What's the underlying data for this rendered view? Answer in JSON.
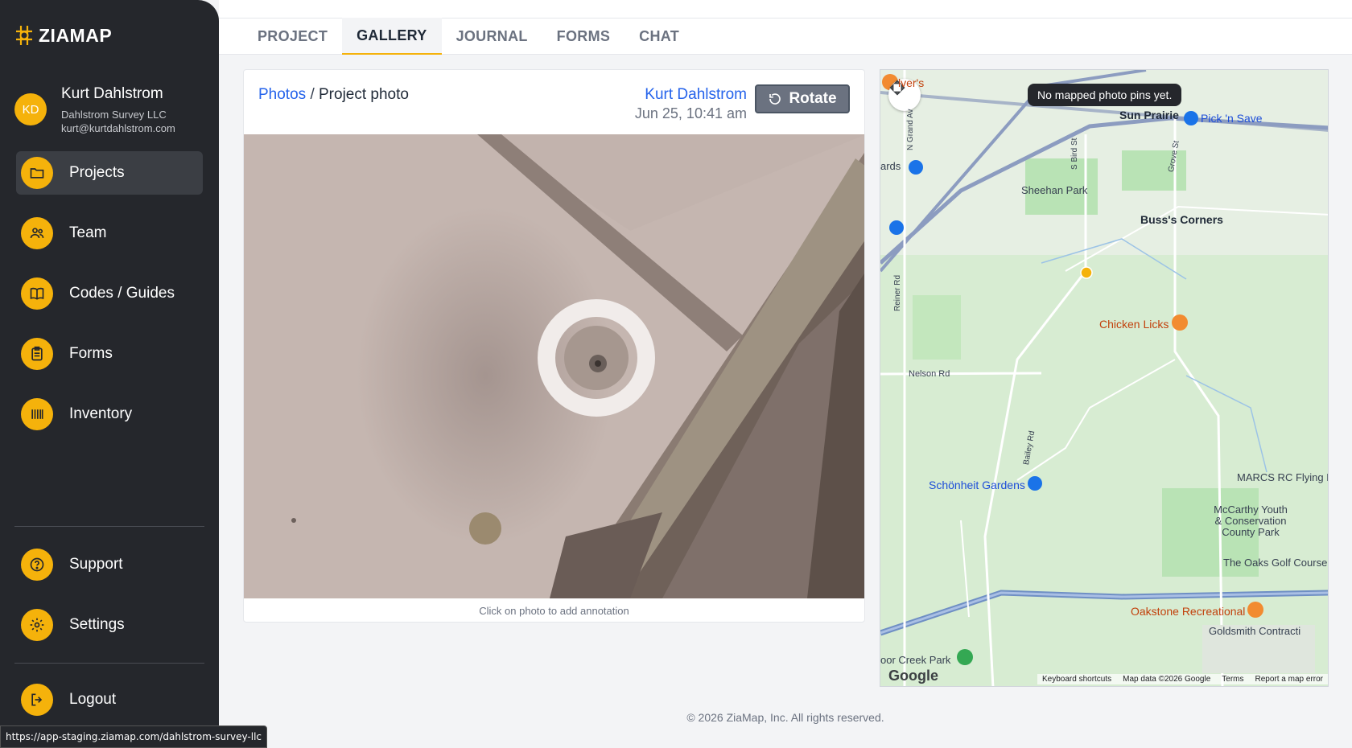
{
  "brand": {
    "name": "ZIAMAP"
  },
  "user": {
    "initials": "KD",
    "name": "Kurt Dahlstrom",
    "company": "Dahlstrom Survey LLC",
    "email": "kurt@kurtdahlstrom.com"
  },
  "nav": {
    "projects": "Projects",
    "team": "Team",
    "codes": "Codes / Guides",
    "forms": "Forms",
    "inventory": "Inventory",
    "support": "Support",
    "settings": "Settings",
    "logout": "Logout"
  },
  "tabs": {
    "project": "PROJECT",
    "gallery": "GALLERY",
    "journal": "JOURNAL",
    "forms": "FORMS",
    "chat": "CHAT"
  },
  "photo": {
    "breadcrumb_link": "Photos",
    "breadcrumb_sep": "/",
    "breadcrumb_current": "Project photo",
    "author": "Kurt Dahlstrom",
    "date": "Jun 25, 10:41 am",
    "rotate_label": "Rotate",
    "hint": "Click on photo to add annotation"
  },
  "map": {
    "tooltip": "No mapped photo pins yet.",
    "labels": {
      "sun_prairie": "Sun Prairie",
      "pick_n_save": "Pick 'n Save",
      "sheehan_park": "Sheehan Park",
      "buss_corners": "Buss's Corners",
      "chicken_licks": "Chicken Licks",
      "nelson_rd": "Nelson Rd",
      "schonheit": "Schönheit Gardens",
      "marcs": "MARCS RC Flying Fi",
      "mccarthy": "McCarthy Youth & Conservation County Park",
      "oaks_golf": "The Oaks Golf Course",
      "oakstone": "Oakstone Recreational",
      "goldsmith": "Goldsmith Contracti",
      "creek_park": "oor Creek Park",
      "ards": "ards",
      "culvers": "lver's",
      "reiner_rd": "Reiner Rd",
      "bailey_rd": "Bailey Rd",
      "bird_st": "S Bird St",
      "grove_st": "Grove St",
      "grand_ave": "N Grand Av"
    },
    "google": "Google",
    "footer": {
      "shortcuts": "Keyboard shortcuts",
      "data": "Map data ©2026 Google",
      "terms": "Terms",
      "report": "Report a map error"
    }
  },
  "footer": {
    "copyright": "© 2026 ZiaMap, Inc. All rights reserved."
  },
  "status_url": "https://app-staging.ziamap.com/dahlstrom-survey-llc",
  "colors": {
    "accent": "#f5b20b",
    "sidebar": "#25272c",
    "link": "#2563eb"
  }
}
